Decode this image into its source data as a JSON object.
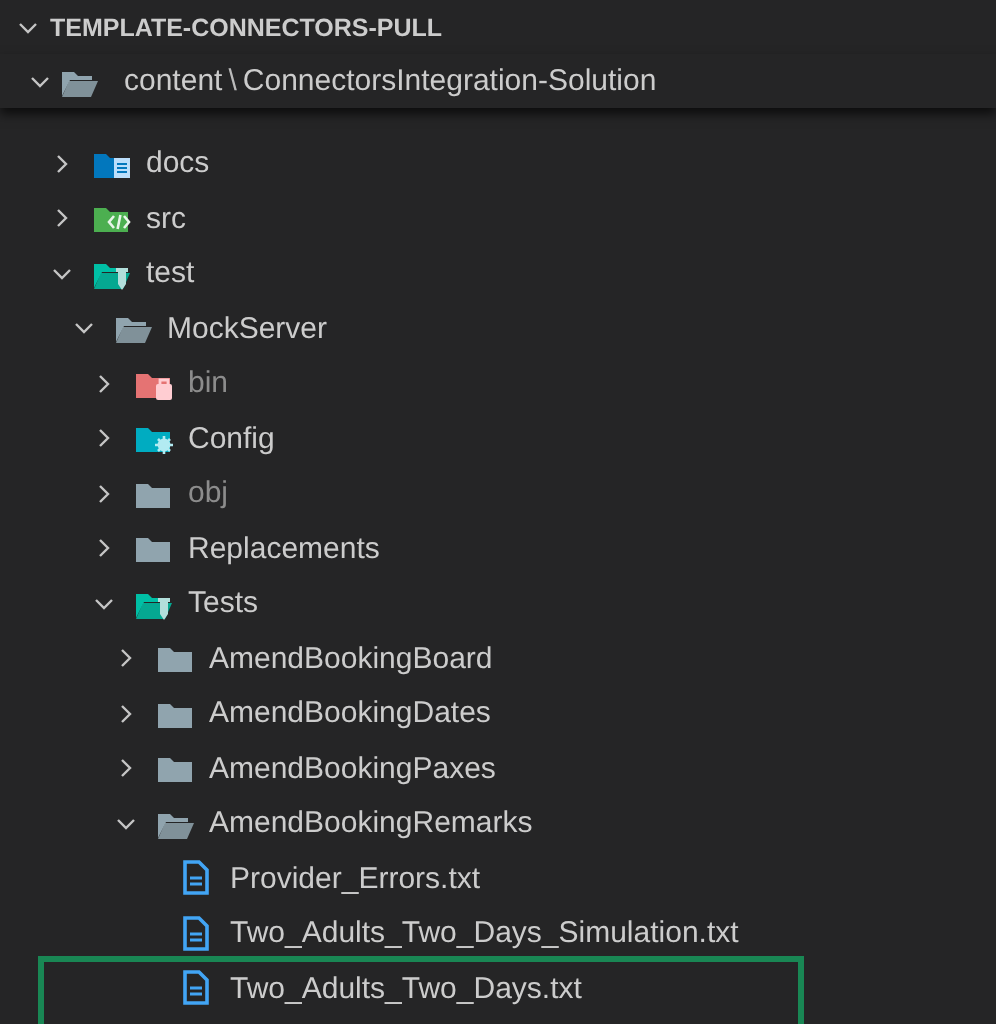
{
  "section": {
    "title": "TEMPLATE-CONNECTORS-PULL",
    "expanded": true
  },
  "root": {
    "segments": [
      "content",
      "ConnectorsIntegration-Solution"
    ],
    "separator": "\\",
    "expanded": true
  },
  "tree": [
    {
      "name": "docs",
      "kind": "docs-folder",
      "expanded": false,
      "dimmed": false
    },
    {
      "name": "src",
      "kind": "code-folder",
      "expanded": false,
      "dimmed": false
    },
    {
      "name": "test",
      "kind": "test-folder",
      "expanded": true,
      "dimmed": false,
      "children": [
        {
          "name": "MockServer",
          "kind": "folder",
          "expanded": true,
          "dimmed": false,
          "children": [
            {
              "name": "bin",
              "kind": "bin-folder",
              "expanded": false,
              "dimmed": true
            },
            {
              "name": "Config",
              "kind": "config-folder",
              "expanded": false,
              "dimmed": false
            },
            {
              "name": "obj",
              "kind": "folder",
              "expanded": false,
              "dimmed": true
            },
            {
              "name": "Replacements",
              "kind": "folder",
              "expanded": false,
              "dimmed": false
            },
            {
              "name": "Tests",
              "kind": "test-folder",
              "expanded": true,
              "dimmed": false,
              "children": [
                {
                  "name": "AmendBookingBoard",
                  "kind": "folder",
                  "expanded": false,
                  "dimmed": false
                },
                {
                  "name": "AmendBookingDates",
                  "kind": "folder",
                  "expanded": false,
                  "dimmed": false
                },
                {
                  "name": "AmendBookingPaxes",
                  "kind": "folder",
                  "expanded": false,
                  "dimmed": false
                },
                {
                  "name": "AmendBookingRemarks",
                  "kind": "folder",
                  "expanded": true,
                  "dimmed": false,
                  "children": [
                    {
                      "name": "Provider_Errors.txt",
                      "kind": "text-file",
                      "highlighted": false
                    },
                    {
                      "name": "Two_Adults_Two_Days_Simulation.txt",
                      "kind": "text-file",
                      "highlighted": false
                    },
                    {
                      "name": "Two_Adults_Two_Days.txt",
                      "kind": "text-file",
                      "highlighted": true
                    }
                  ]
                }
              ]
            }
          ]
        }
      ]
    }
  ]
}
